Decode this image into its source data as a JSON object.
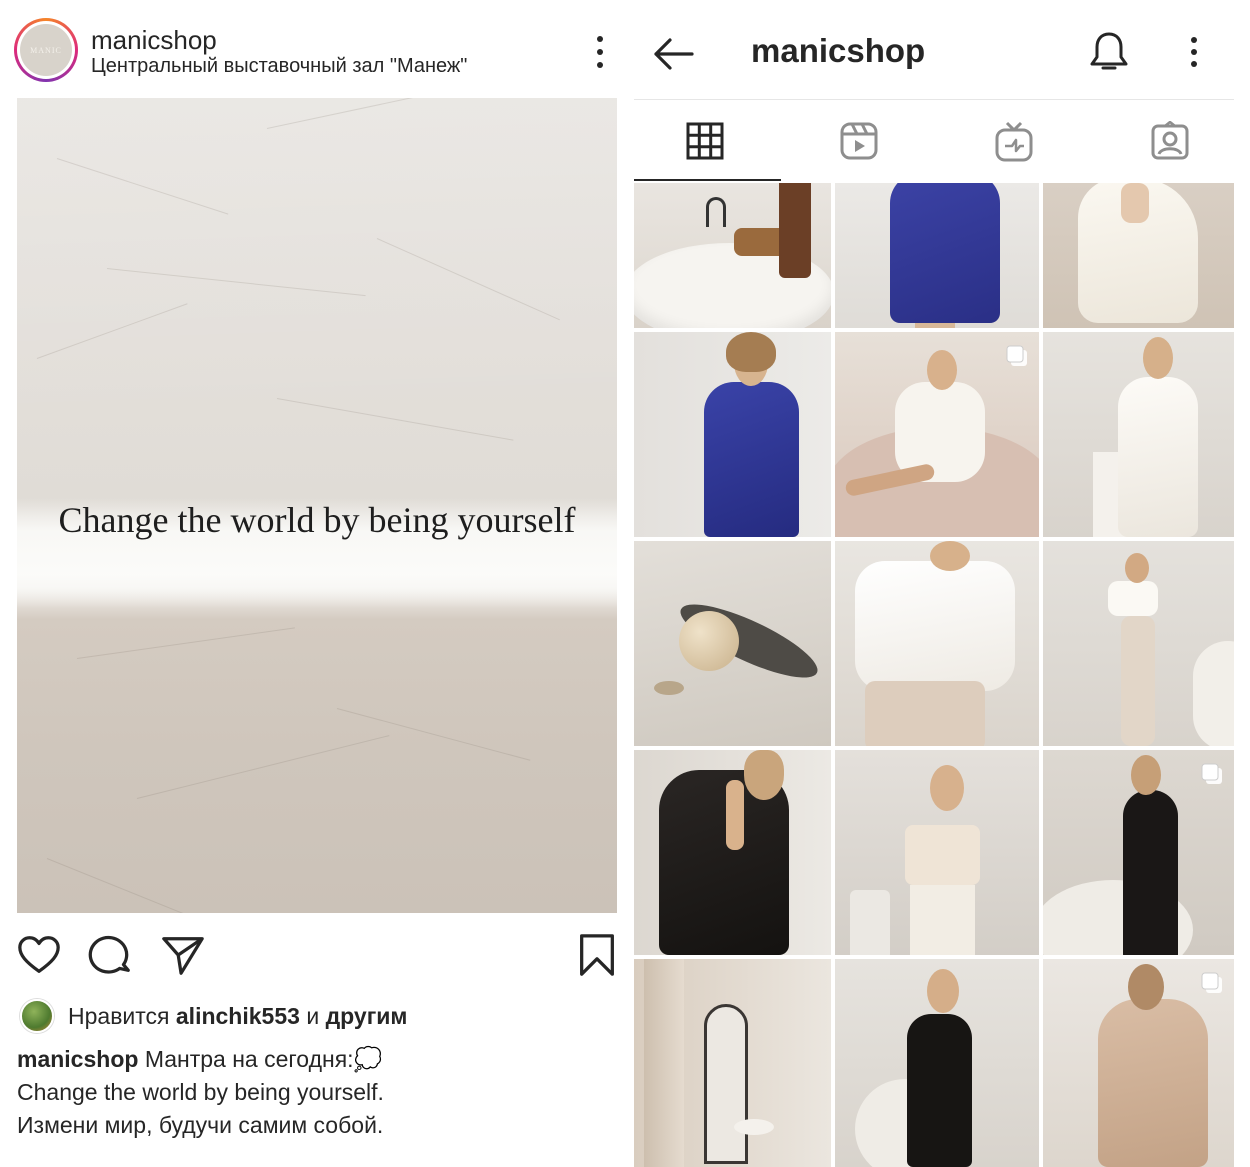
{
  "post": {
    "username": "manicshop",
    "location": "Центральный выставочный зал \"Манеж\"",
    "avatar_text": "MANIC",
    "image_quote": "Change the world by being yourself",
    "likes": {
      "prefix": "Нравится",
      "user": "alinchik553",
      "conj": "и",
      "others": "другим"
    },
    "caption": {
      "username": "manicshop",
      "line1": "Мантра на сегодня:💭",
      "line2": "Change the world by being yourself.",
      "line3": "Измени мир, будучи самим собой."
    }
  },
  "profile": {
    "title": "manicshop",
    "tabs": [
      "grid-tab",
      "reels-tab",
      "igtv-tab",
      "tagged-tab"
    ]
  },
  "colors": {
    "text": "#262626",
    "divider": "#e6e6e6",
    "ring_start": "#f58529",
    "ring_mid": "#dd2a7b"
  }
}
